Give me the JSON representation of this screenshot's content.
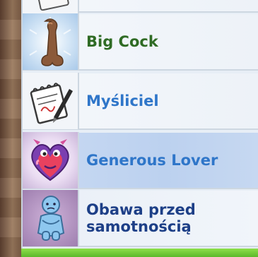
{
  "traits": [
    {
      "label": "Big Cock",
      "icon": "cock-icon",
      "color": "#2f6b24"
    },
    {
      "label": "Myśliciel",
      "icon": "notepad-pen-icon",
      "color": "#2f76c9"
    },
    {
      "label": "Generous Lover",
      "icon": "heart-monster-icon",
      "color": "#2f76c9"
    },
    {
      "label": "Obawa przed samotnością",
      "icon": "lonely-figure-icon",
      "color": "#1d3f87"
    }
  ],
  "colors": {
    "row_selected": "#c9daf3",
    "bottom_bar": "#6fcb36"
  }
}
